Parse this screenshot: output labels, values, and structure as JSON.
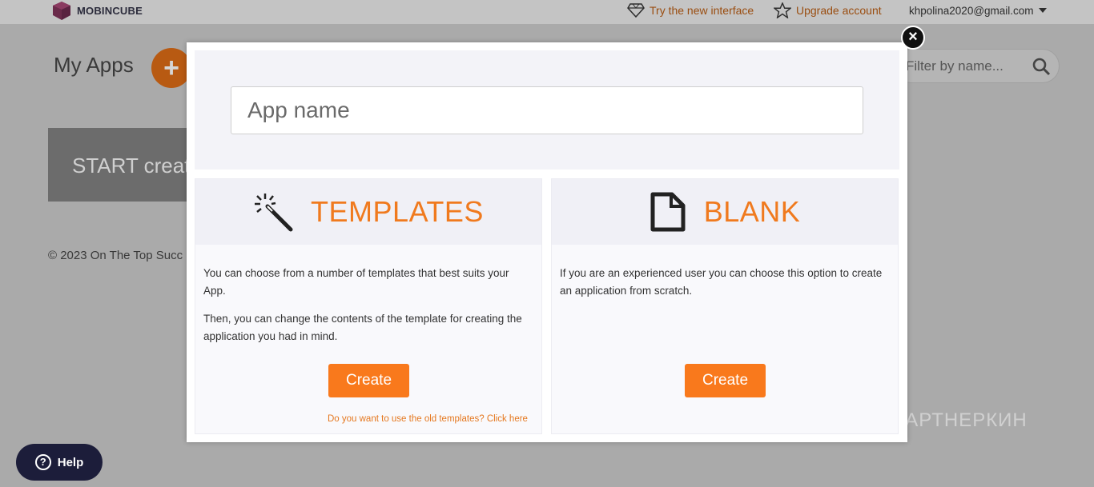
{
  "header": {
    "brand": "MOBINCUBE",
    "try_new": "Try the new interface",
    "upgrade": "Upgrade account",
    "user_email": "khpolina2020@gmail.com"
  },
  "main": {
    "title": "My Apps",
    "start_label": "START creat",
    "copyright": "© 2023 On The Top Succ",
    "filter_placeholder": "Filter by name..."
  },
  "modal": {
    "app_name_placeholder": "App name",
    "templates": {
      "title": "TEMPLATES",
      "paragraph1": "You can choose from a number of templates that best suits your App.",
      "paragraph2": "Then, you can change the contents of the template for creating the application you had in mind.",
      "create_label": "Create",
      "old_templates_link": "Do you want to use the old templates? Click here"
    },
    "blank": {
      "title": "BLANK",
      "paragraph1": "If you are an experienced user you can choose this option to create an application from scratch.",
      "create_label": "Create"
    },
    "close_label": "×"
  },
  "help": {
    "label": "Help"
  },
  "watermark": "ПАРТНЕРКИН",
  "colors": {
    "accent": "#f9791c",
    "title_orange": "#f07a1e",
    "help_bg": "#1c1d3a"
  }
}
